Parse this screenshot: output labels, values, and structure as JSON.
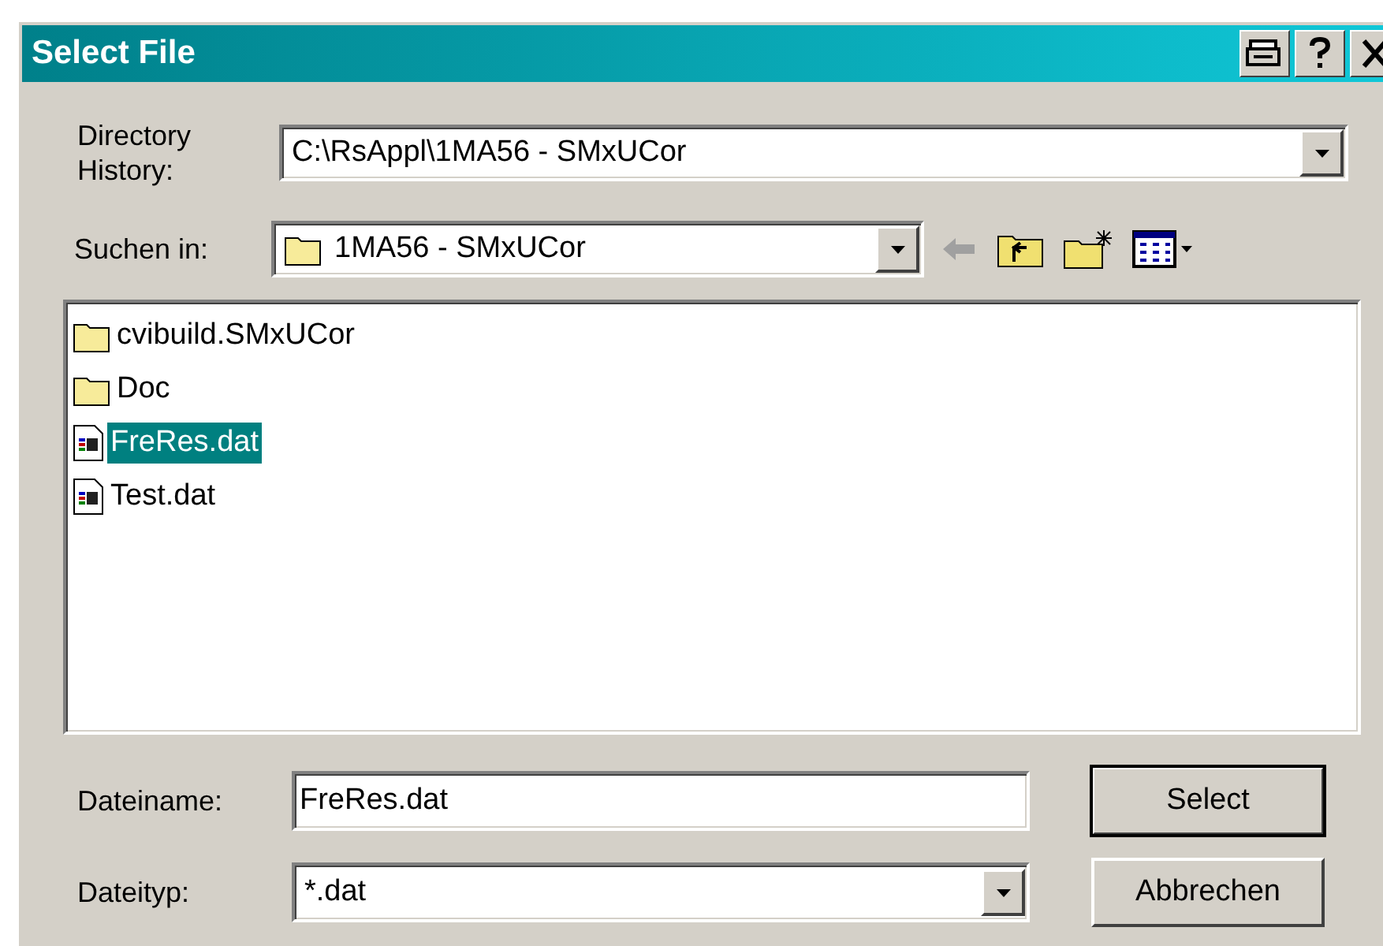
{
  "window": {
    "title": "Select File"
  },
  "directory_history": {
    "label": "Directory History:",
    "value": "C:\\RsAppl\\1MA56 - SMxUCor"
  },
  "look_in": {
    "label": "Suchen in:",
    "value": "1MA56 - SMxUCor"
  },
  "files": [
    {
      "name": "cvibuild.SMxUCor",
      "kind": "folder",
      "selected": false
    },
    {
      "name": "Doc",
      "kind": "folder",
      "selected": false
    },
    {
      "name": "FreRes.dat",
      "kind": "file",
      "selected": true
    },
    {
      "name": "Test.dat",
      "kind": "file",
      "selected": false
    }
  ],
  "file_name": {
    "label": "Dateiname:",
    "value": "FreRes.dat"
  },
  "file_type": {
    "label": "Dateityp:",
    "value": "*.dat"
  },
  "buttons": [
    {
      "label": "Select",
      "default": true
    },
    {
      "label": "Abbrechen",
      "default": false
    }
  ]
}
